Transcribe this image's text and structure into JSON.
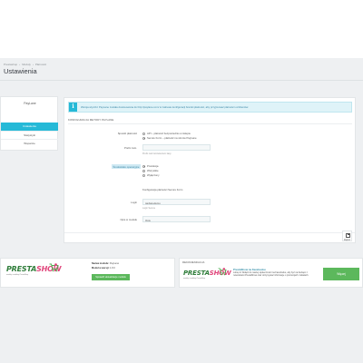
{
  "breadcrumb": [
    "Prestashop",
    "Moduły",
    "Płatności"
  ],
  "page": {
    "title": "Ustawienia"
  },
  "module": {
    "name": "PayLane",
    "menu": [
      {
        "label": "Ustawienia",
        "active": true
      },
      {
        "label": "Statystyki",
        "active": false
      },
      {
        "label": "Wsparcie",
        "active": false
      }
    ]
  },
  "alert": {
    "text": "Wersja wtyczki: PayLane została dostosowana do http://paylane.com/ w zakresie konfiguracji bramki płatności, aby przyjmować płatności od klientów."
  },
  "form": {
    "section_title": "KONFIGURACJA METODY PAYLANE",
    "payment_type": {
      "label": "Sposób płatności",
      "options": [
        {
          "label": "API – płatność bezpośrednio w sklepie",
          "checked": false
        },
        {
          "label": "Secure Form – płatność na stronie PayLane",
          "checked": true
        }
      ]
    },
    "order_prefix": {
      "label": "Prefix zam.",
      "value": "",
      "help": "Prefix nad zamówieniem kasy"
    },
    "environment": {
      "label": "Środowisko operacyjne",
      "options": [
        {
          "label": "Produkcja",
          "checked": true
        },
        {
          "label": "Wszystkie",
          "checked": false
        },
        {
          "label": "Wyłączony",
          "checked": false
        }
      ]
    },
    "secure_form_title": "Konfiguracja płatności Secure Form",
    "login": {
      "label": "Login",
      "value": "paylanedemo",
      "help": "Login Secure"
    },
    "language": {
      "label": "Opis w modułu",
      "value": "Opis"
    },
    "save_label": "Zapisz"
  },
  "footer_left": {
    "logo_main": "PRESTA",
    "logo_accent": "SHOW",
    "logo_tagline": "moduły i szablony PrestaShop",
    "module_name_label": "Nazwa modułu:",
    "module_name_value": "PayLane",
    "version_label": "Moduł w wersji:",
    "version_value": "1.8.0",
    "check_button": "Sprawdź aktualizacje modułu"
  },
  "footer_right": {
    "section_title": "REKOMENDACJA",
    "logo_main": "PRESTA",
    "logo_accent": "SHOW",
    "logo_tagline": "moduły i szablony PrestaShop",
    "rec_title": "PrestaShow na Facebooku",
    "rec_desc": "Lubię to! Dołącz do naszej społeczności na Facebooku, aby być na bieżąco z nowościami PrestaShow oraz otrzymywać informacje o promocjach i rabatach.",
    "more_button": "Więcej"
  },
  "colors": {
    "accent": "#25b9d7",
    "green": "#5cb85c",
    "brand_green": "#2f7d3a",
    "brand_pink": "#e0457b"
  }
}
